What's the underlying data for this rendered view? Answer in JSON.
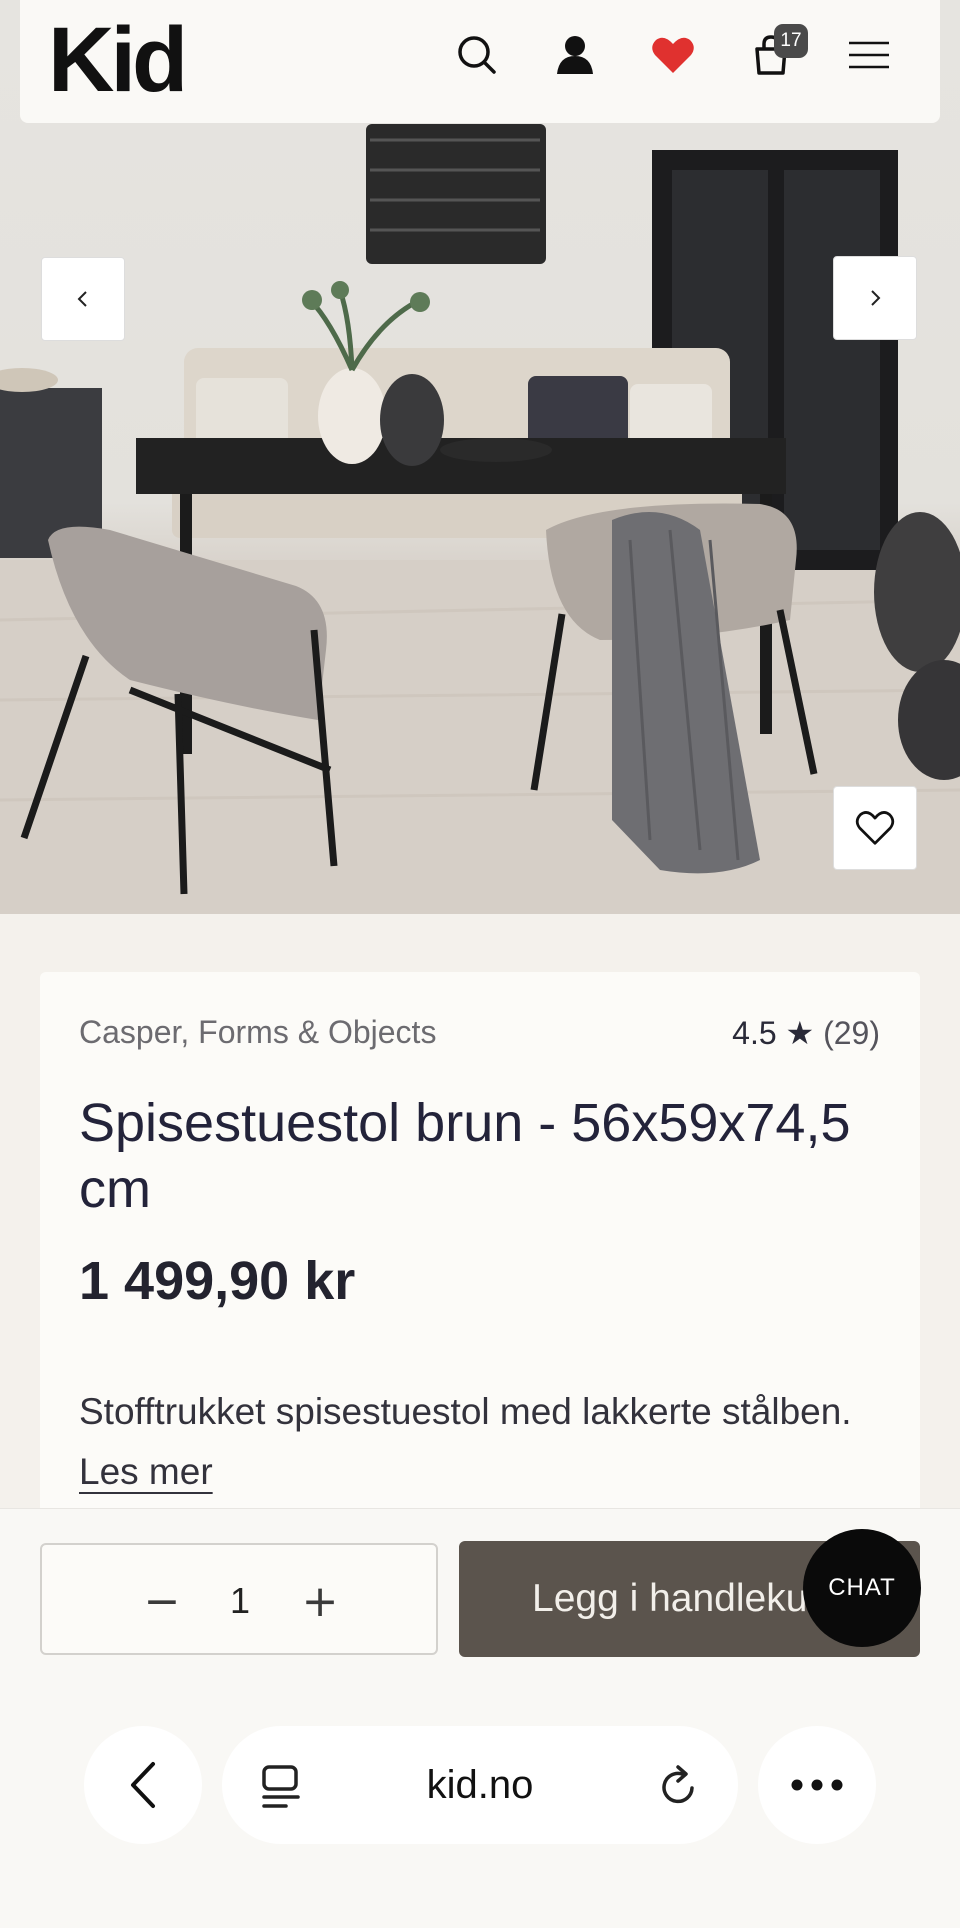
{
  "header": {
    "logo": "Kid",
    "cart_count": "17",
    "icons": [
      "search-icon",
      "user-icon",
      "heart-icon",
      "cart-icon",
      "menu-icon"
    ],
    "heart_color": "#e0312f"
  },
  "gallery": {
    "prev_icon": "chevron-left-icon",
    "next_icon": "chevron-right-icon",
    "favorite_icon": "heart-outline-icon"
  },
  "product": {
    "brand": "Casper, Forms & Objects",
    "rating": "4.5",
    "rating_star": "★",
    "rating_count": "(29)",
    "title": "Spisestuestol brun - 56x59x74,5 cm",
    "price": "1 499,90 kr",
    "description": "Stofftrukket spisestuestol med lakkerte stålben.",
    "read_more": "Les mer"
  },
  "purchase": {
    "minus": "−",
    "quantity": "1",
    "plus": "+",
    "add_to_cart": "Legg i handlekurv",
    "button_color": "#5b544d"
  },
  "chat": {
    "label": "CHAT"
  },
  "browser": {
    "url": "kid.no",
    "icons": [
      "back-icon",
      "tabs-icon",
      "reload-icon",
      "more-icon"
    ]
  }
}
